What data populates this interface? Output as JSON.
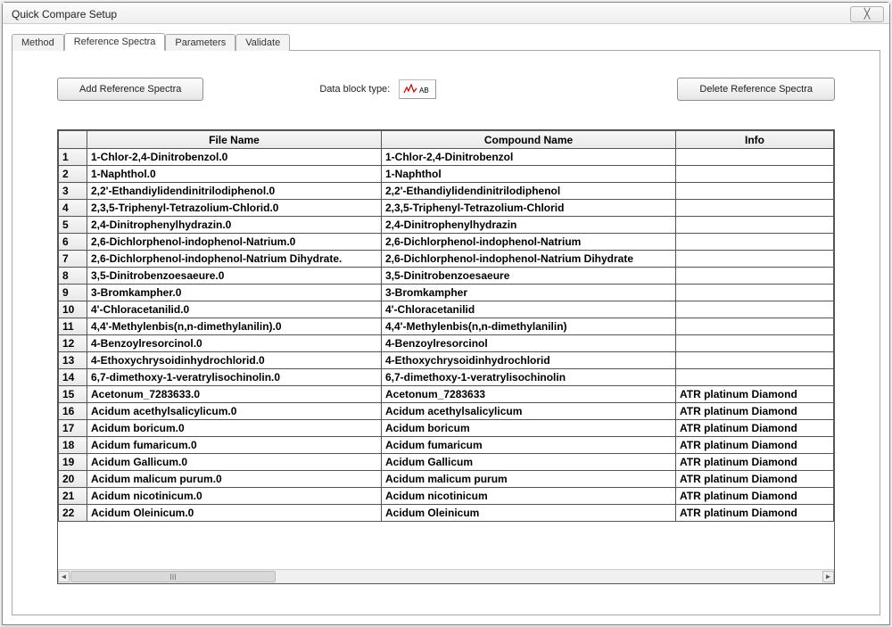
{
  "window": {
    "title": "Quick Compare Setup",
    "close_symbol": "╳"
  },
  "tabs": {
    "method": "Method",
    "reference_spectra": "Reference Spectra",
    "parameters": "Parameters",
    "validate": "Validate"
  },
  "toolbar": {
    "add_button": "Add Reference Spectra",
    "datablock_label": "Data block type:",
    "datablock_value": "AB",
    "delete_button": "Delete Reference Spectra"
  },
  "table": {
    "headers": {
      "rownum": "",
      "filename": "File Name",
      "compound": "Compound Name",
      "info": "Info"
    },
    "rows": [
      {
        "n": "1",
        "file": "1-Chlor-2,4-Dinitrobenzol.0",
        "compound": "1-Chlor-2,4-Dinitrobenzol",
        "info": ""
      },
      {
        "n": "2",
        "file": "1-Naphthol.0",
        "compound": "1-Naphthol",
        "info": ""
      },
      {
        "n": "3",
        "file": "2,2'-Ethandiylidendinitrilodiphenol.0",
        "compound": "2,2'-Ethandiylidendinitrilodiphenol",
        "info": ""
      },
      {
        "n": "4",
        "file": "2,3,5-Triphenyl-Tetrazolium-Chlorid.0",
        "compound": "2,3,5-Triphenyl-Tetrazolium-Chlorid",
        "info": ""
      },
      {
        "n": "5",
        "file": "2,4-Dinitrophenylhydrazin.0",
        "compound": "2,4-Dinitrophenylhydrazin",
        "info": ""
      },
      {
        "n": "6",
        "file": "2,6-Dichlorphenol-indophenol-Natrium.0",
        "compound": "2,6-Dichlorphenol-indophenol-Natrium",
        "info": ""
      },
      {
        "n": "7",
        "file": "2,6-Dichlorphenol-indophenol-Natrium Dihydrate.",
        "compound": "2,6-Dichlorphenol-indophenol-Natrium Dihydrate",
        "info": ""
      },
      {
        "n": "8",
        "file": "3,5-Dinitrobenzoesaeure.0",
        "compound": "3,5-Dinitrobenzoesaeure",
        "info": ""
      },
      {
        "n": "9",
        "file": "3-Bromkampher.0",
        "compound": "3-Bromkampher",
        "info": ""
      },
      {
        "n": "10",
        "file": "4'-Chloracetanilid.0",
        "compound": "4'-Chloracetanilid",
        "info": ""
      },
      {
        "n": "11",
        "file": "4,4'-Methylenbis(n,n-dimethylanilin).0",
        "compound": "4,4'-Methylenbis(n,n-dimethylanilin)",
        "info": ""
      },
      {
        "n": "12",
        "file": "4-Benzoylresorcinol.0",
        "compound": "4-Benzoylresorcinol",
        "info": ""
      },
      {
        "n": "13",
        "file": "4-Ethoxychrysoidinhydrochlorid.0",
        "compound": "4-Ethoxychrysoidinhydrochlorid",
        "info": ""
      },
      {
        "n": "14",
        "file": "6,7-dimethoxy-1-veratrylisochinolin.0",
        "compound": "6,7-dimethoxy-1-veratrylisochinolin",
        "info": ""
      },
      {
        "n": "15",
        "file": "Acetonum_7283633.0",
        "compound": "Acetonum_7283633",
        "info": "ATR platinum Diamond"
      },
      {
        "n": "16",
        "file": "Acidum acethylsalicylicum.0",
        "compound": "Acidum acethylsalicylicum",
        "info": "ATR platinum Diamond"
      },
      {
        "n": "17",
        "file": "Acidum boricum.0",
        "compound": "Acidum boricum",
        "info": "ATR platinum Diamond"
      },
      {
        "n": "18",
        "file": "Acidum fumaricum.0",
        "compound": "Acidum fumaricum",
        "info": "ATR platinum Diamond"
      },
      {
        "n": "19",
        "file": "Acidum Gallicum.0",
        "compound": "Acidum Gallicum",
        "info": "ATR platinum Diamond"
      },
      {
        "n": "20",
        "file": "Acidum malicum purum.0",
        "compound": "Acidum malicum purum",
        "info": "ATR platinum Diamond"
      },
      {
        "n": "21",
        "file": "Acidum nicotinicum.0",
        "compound": "Acidum nicotinicum",
        "info": "ATR platinum Diamond"
      },
      {
        "n": "22",
        "file": "Acidum Oleinicum.0",
        "compound": "Acidum Oleinicum",
        "info": "ATR platinum Diamond"
      }
    ]
  },
  "hscroll_grip": "III"
}
